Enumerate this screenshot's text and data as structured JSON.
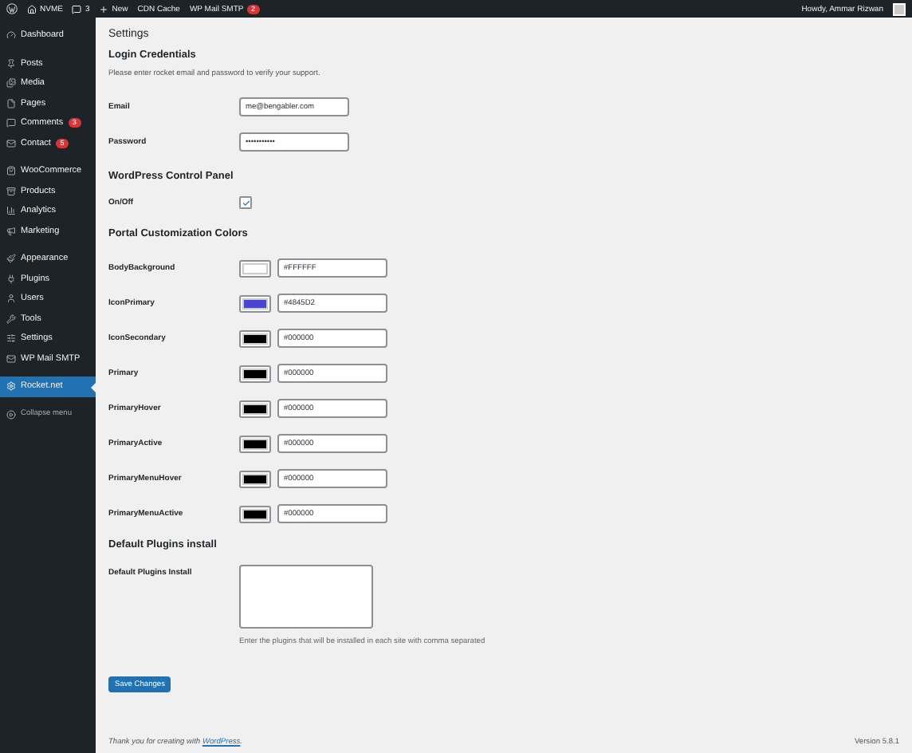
{
  "admin_bar": {
    "site": "NVME",
    "comments": "3",
    "new": "New",
    "items": [
      {
        "label": "CDN Cache"
      },
      {
        "label": "WP Mail SMTP",
        "badge": "2"
      }
    ],
    "greeting": "Howdy, Ammar Rizwan"
  },
  "sidebar": {
    "groups": [
      {
        "items": [
          {
            "label": "Dashboard",
            "selected": false
          }
        ]
      },
      {
        "items": [
          {
            "label": "Posts",
            "selected": false
          },
          {
            "label": "Media",
            "selected": false
          },
          {
            "label": "Pages",
            "selected": false
          },
          {
            "label": "Comments",
            "badge": "3",
            "selected": false
          },
          {
            "label": "Contact",
            "badge": "5",
            "selected": false
          }
        ]
      },
      {
        "items": [
          {
            "label": "WooCommerce",
            "selected": false
          },
          {
            "label": "Products",
            "selected": false
          },
          {
            "label": "Analytics",
            "selected": false
          },
          {
            "label": "Marketing",
            "selected": false
          }
        ]
      },
      {
        "items": [
          {
            "label": "Appearance",
            "selected": false
          },
          {
            "label": "Plugins",
            "selected": false
          },
          {
            "label": "Users",
            "selected": false
          },
          {
            "label": "Tools",
            "selected": false
          },
          {
            "label": "Settings",
            "selected": false
          },
          {
            "label": "WP Mail SMTP",
            "selected": false
          }
        ]
      },
      {
        "items": [
          {
            "label": "Rocket.net",
            "selected": true
          }
        ]
      }
    ],
    "collapse": "Collapse menu"
  },
  "page_title": "Settings",
  "login": {
    "heading": "Login Credentials",
    "description": "Please enter rocket email and password to verify your support.",
    "email": {
      "label": "Email",
      "value": "me@bengabler.com"
    },
    "password": {
      "label": "Password",
      "value": "•••••••••••"
    }
  },
  "control_panel": {
    "heading": "WordPress Control Panel",
    "toggle": {
      "label": "On/Off",
      "checked": true
    }
  },
  "colors": {
    "heading": "Portal Customization Colors",
    "rows": [
      {
        "label": "BodyBackground",
        "color": "#ffffff",
        "value": "#FFFFFF"
      },
      {
        "label": "IconPrimary",
        "color": "#4845d2",
        "value": "#4845D2"
      },
      {
        "label": "IconSecondary",
        "color": "#000000",
        "value": "#000000"
      },
      {
        "label": "Primary",
        "color": "#000000",
        "value": "#000000"
      },
      {
        "label": "PrimaryHover",
        "color": "#000000",
        "value": "#000000"
      },
      {
        "label": "PrimaryActive",
        "color": "#000000",
        "value": "#000000"
      },
      {
        "label": "PrimaryMenuHover",
        "color": "#000000",
        "value": "#000000"
      },
      {
        "label": "PrimaryMenuActive",
        "color": "#000000",
        "value": "#000000"
      }
    ]
  },
  "plugins": {
    "heading": "Default Plugins install",
    "label": "Default Plugins Install",
    "hint": "Enter the plugins that will be installed in each site with comma separated"
  },
  "save_button": "Save Changes",
  "footer": {
    "thanks_before": "Thank you for creating with",
    "link": "WordPress",
    "thanks_after": ".",
    "version": "Version 5.8.1"
  }
}
